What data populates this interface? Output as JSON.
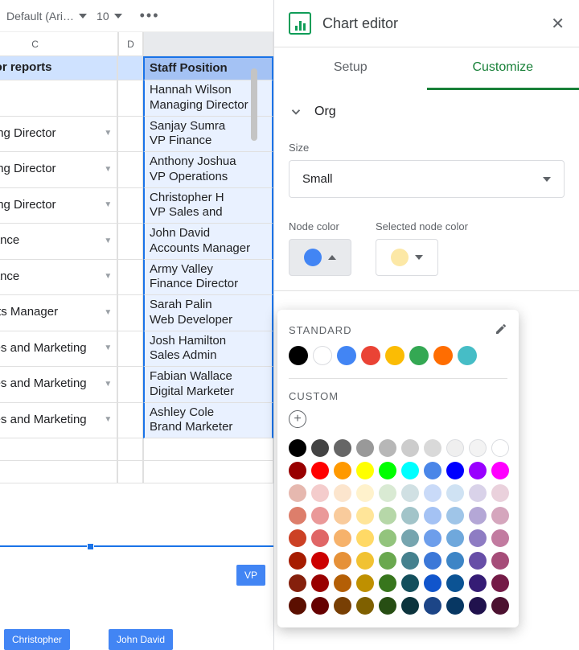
{
  "toolbar": {
    "font": "Default (Ari…",
    "font_size": "10",
    "more_icon": "more-horizontal",
    "collapse_icon": "chevron-up"
  },
  "columns": {
    "c": "C",
    "d": "D",
    "e_visible": ""
  },
  "header_row": {
    "c": "Superior reports",
    "d": "",
    "e": "Staff Position"
  },
  "rows": [
    {
      "c": "",
      "e": "Hannah Wilson\nManaging Director"
    },
    {
      "c": "Managing Director",
      "e": "Sanjay Sumra\nVP Finance"
    },
    {
      "c": "Managing Director",
      "e": "Anthony Joshua\nVP Operations"
    },
    {
      "c": "Managing Director",
      "e": "Christopher H\nVP Sales and"
    },
    {
      "c": "VP Finance",
      "e": "John David\nAccounts Manager"
    },
    {
      "c": "VP Finance",
      "e": "Army Valley\nFinance Director"
    },
    {
      "c": "Accounts Manager",
      "e": "Sarah Palin\nWeb Developer"
    },
    {
      "c": "VP Sales and Marketing",
      "e": "Josh Hamilton\nSales Admin"
    },
    {
      "c": "VP Sales and Marketing",
      "e": "Fabian Wallace\nDigital Marketer"
    },
    {
      "c": "VP Sales and Marketing",
      "e": "Ashley Cole\nBrand Marketer"
    }
  ],
  "chart_nodes": {
    "partial": "VP",
    "left": "Christopher",
    "right": "John David"
  },
  "panel": {
    "title": "Chart editor",
    "tab_setup": "Setup",
    "tab_customize": "Customize",
    "section": "Org",
    "size_label": "Size",
    "size_value": "Small",
    "node_color_label": "Node color",
    "selected_node_color_label": "Selected node color",
    "node_color": "#4285f4",
    "selected_node_color": "#fce8a6"
  },
  "color_picker": {
    "standard_label": "STANDARD",
    "custom_label": "CUSTOM",
    "edit_icon": "pencil",
    "standard": [
      "#000000",
      "outline",
      "#4285f4",
      "#ea4335",
      "#fbbc04",
      "#34a853",
      "#ff6d01",
      "#46bdc6"
    ],
    "palette": [
      "#000000",
      "#434343",
      "#666666",
      "#999999",
      "#b7b7b7",
      "#cccccc",
      "#d9d9d9",
      "#efefef",
      "#f3f3f3",
      "#ffffff",
      "#980000",
      "#ff0000",
      "#ff9900",
      "#ffff00",
      "#00ff00",
      "#00ffff",
      "#4a86e8",
      "#0000ff",
      "#9900ff",
      "#ff00ff",
      "#e6b8af",
      "#f4cccc",
      "#fce5cd",
      "#fff2cc",
      "#d9ead3",
      "#d0e0e3",
      "#c9daf8",
      "#cfe2f3",
      "#d9d2e9",
      "#ead1dc",
      "#dd7e6b",
      "#ea9999",
      "#f9cb9c",
      "#ffe599",
      "#b6d7a8",
      "#a2c4c9",
      "#a4c2f4",
      "#9fc5e8",
      "#b4a7d6",
      "#d5a6bd",
      "#cc4125",
      "#e06666",
      "#f6b26b",
      "#ffd966",
      "#93c47d",
      "#76a5af",
      "#6d9eeb",
      "#6fa8dc",
      "#8e7cc3",
      "#c27ba0",
      "#a61c00",
      "#cc0000",
      "#e69138",
      "#f1c232",
      "#6aa84f",
      "#45818e",
      "#3c78d8",
      "#3d85c6",
      "#674ea7",
      "#a64d79",
      "#85200c",
      "#990000",
      "#b45f06",
      "#bf9000",
      "#38761d",
      "#134f5c",
      "#1155cc",
      "#0b5394",
      "#351c75",
      "#741b47",
      "#5b0f00",
      "#660000",
      "#783f04",
      "#7f6000",
      "#274e13",
      "#0c343d",
      "#1c4587",
      "#073763",
      "#20124d",
      "#4c1130"
    ]
  }
}
